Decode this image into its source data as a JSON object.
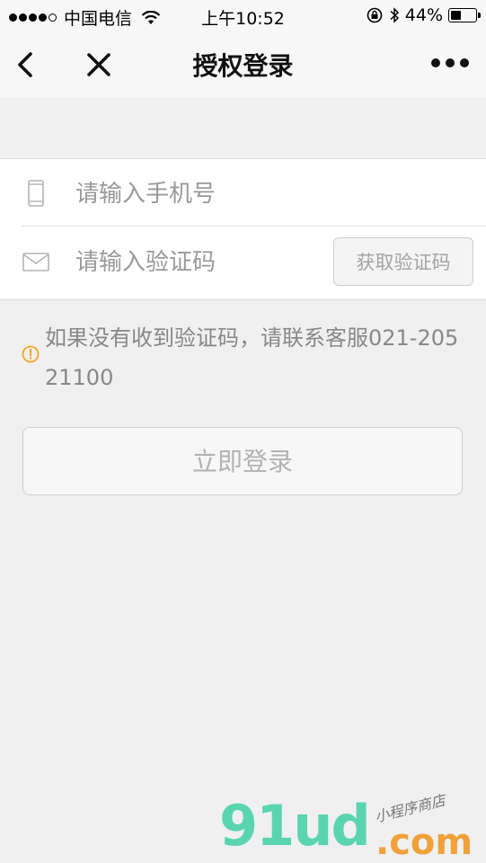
{
  "status_bar": {
    "carrier": "中国电信",
    "time": "上午10:52",
    "battery": "44%",
    "battery_level": 0.44
  },
  "nav": {
    "title": "授权登录"
  },
  "form": {
    "phone_placeholder": "请输入手机号",
    "code_placeholder": "请输入验证码",
    "get_code_label": "获取验证码"
  },
  "notice": {
    "text": "如果没有收到验证码，请联系客服021-20521100"
  },
  "login_button": "立即登录",
  "watermark": {
    "logo": "91ud",
    "tag": "小程序商店",
    "com": ".com"
  },
  "colors": {
    "notice_icon": "#f5a623",
    "watermark_green": "#5ad5b0",
    "watermark_orange": "#f0a13a"
  }
}
